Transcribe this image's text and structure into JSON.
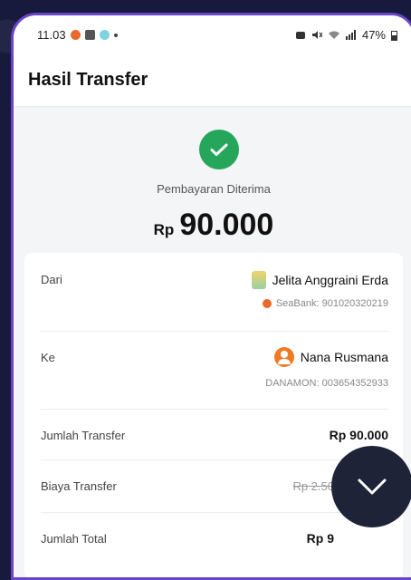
{
  "status_bar": {
    "time": "11.03",
    "battery": "47%"
  },
  "header": {
    "title": "Hasil Transfer"
  },
  "summary": {
    "status": "Pembayaran Diterima",
    "currency": "Rp",
    "amount": "90.000"
  },
  "details": {
    "from": {
      "label": "Dari",
      "name": "Jelita Anggraini Erda",
      "account": "SeaBank: 901020320219"
    },
    "to": {
      "label": "Ke",
      "name": "Nana Rusmana",
      "account": "DANAMON: 003654352933"
    },
    "transfer_amount": {
      "label": "Jumlah Transfer",
      "value": "Rp 90.000"
    },
    "transfer_fee": {
      "label": "Biaya Transfer",
      "value": "Rp 2.50"
    },
    "total": {
      "label": "Jumlah Total",
      "value": "Rp 9"
    }
  },
  "colors": {
    "success": "#26a65b",
    "accent_border": "#6b45c9",
    "fab": "#1e2338"
  },
  "icons": {
    "success": "check-circle-icon",
    "fab": "chevron-down-icon"
  }
}
